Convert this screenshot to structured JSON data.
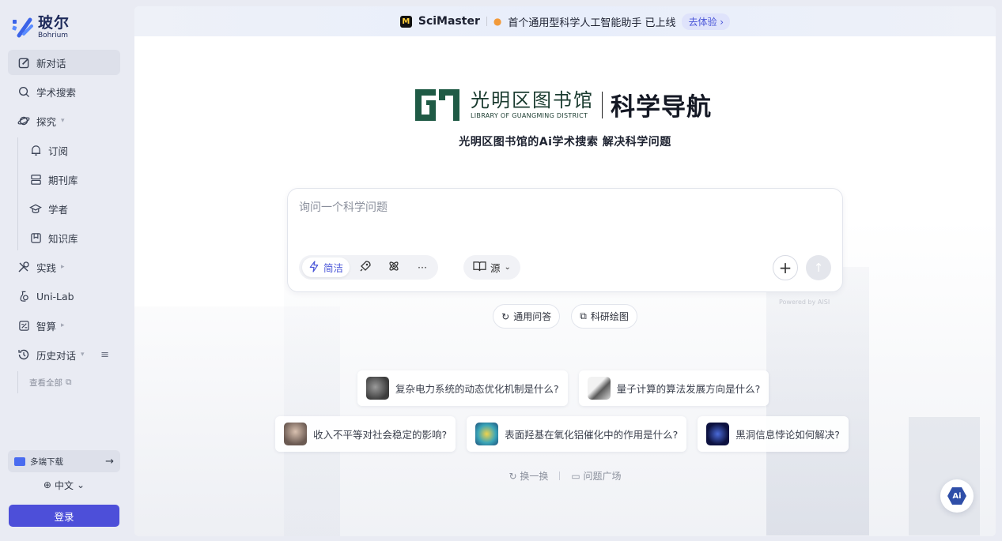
{
  "sidebar": {
    "logo": {
      "cn": "玻尔",
      "en": "Bohrium"
    },
    "items": [
      {
        "label": "新对话",
        "icon": "edit-icon"
      },
      {
        "label": "学术搜索",
        "icon": "search-icon"
      },
      {
        "label": "探究",
        "icon": "planet-icon"
      },
      {
        "label": "订阅",
        "icon": "bell-icon"
      },
      {
        "label": "期刊库",
        "icon": "database-icon"
      },
      {
        "label": "学者",
        "icon": "graduation-cap-icon"
      },
      {
        "label": "知识库",
        "icon": "bookmark-box-icon"
      },
      {
        "label": "实践",
        "icon": "tools-icon"
      },
      {
        "label": "Uni-Lab",
        "icon": "flask-icon"
      },
      {
        "label": "智算",
        "icon": "calculator-icon"
      },
      {
        "label": "历史对话",
        "icon": "history-icon"
      }
    ],
    "view_all": "查看全部",
    "download": "多端下载",
    "language": "中文",
    "login": "登录"
  },
  "banner": {
    "brand": "SciMaster",
    "text": "首个通用型科学人工智能助手 已上线",
    "cta": "去体验 ›"
  },
  "hero": {
    "library_cn": "光明区图书馆",
    "library_en": "LIBRARY OF GUANGMING DISTRICT",
    "title": "科学导航",
    "tagline": "光明区图书馆的Ai学术搜索 解决科学问题"
  },
  "search": {
    "placeholder": "询问一个科学问题",
    "mode_active": "简洁",
    "more": "···",
    "source": "源",
    "powered": "Powered by AISI"
  },
  "chips": [
    {
      "label": "通用问答"
    },
    {
      "label": "科研绘图"
    }
  ],
  "questions": [
    {
      "text": "复杂电力系统的动态优化机制是什么?"
    },
    {
      "text": "量子计算的算法发展方向是什么?"
    },
    {
      "text": "收入不平等对社会稳定的影响?"
    },
    {
      "text": "表面羟基在氧化铝催化中的作用是什么?"
    },
    {
      "text": "黑洞信息悖论如何解决?"
    }
  ],
  "footer": {
    "refresh": "换一换",
    "square": "问题广场"
  },
  "fab": {
    "label": "Ai"
  },
  "colors": {
    "accent": "#4d4fd9",
    "link": "#4a56d8",
    "library_green": "#1f5a45"
  }
}
